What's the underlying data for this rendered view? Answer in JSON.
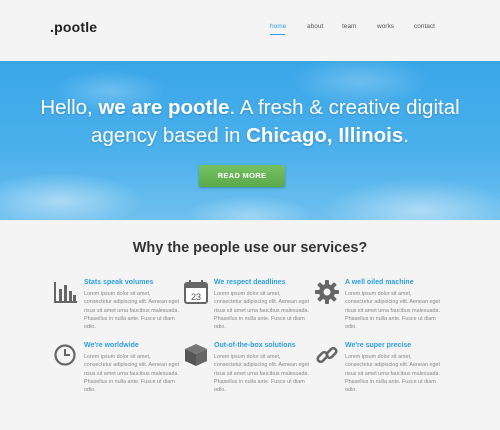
{
  "header": {
    "logo": ".pootle",
    "nav": [
      {
        "label": "home",
        "active": true
      },
      {
        "label": "about",
        "active": false
      },
      {
        "label": "team",
        "active": false
      },
      {
        "label": "works",
        "active": false
      },
      {
        "label": "contact",
        "active": false
      }
    ]
  },
  "hero": {
    "line1_prefix": "Hello, ",
    "line1_bold": "we are pootle",
    "line1_suffix": ". A fresh & creative digital",
    "line2_prefix": "agency based in ",
    "line2_bold": "Chicago, Illinois",
    "line2_suffix": ".",
    "cta_label": "READ MORE"
  },
  "services": {
    "title": "Why the people use our services?",
    "body_text": "Lorem ipsum dolor sit amet, consectetur adipiscing elit. Aenean eget risus sit amet urna faucibus malesuada. Phasellus in nulla ante. Fusce ut diam odio.",
    "items": [
      {
        "title": "Stats speak volumes",
        "icon": "bar-chart-icon"
      },
      {
        "title": "We respect deadlines",
        "icon": "calendar-icon",
        "icon_text": "23"
      },
      {
        "title": "A well oiled machine",
        "icon": "gear-icon"
      },
      {
        "title": "We're worldwide",
        "icon": "clock-icon"
      },
      {
        "title": "Out-of-the-box solutions",
        "icon": "box-icon"
      },
      {
        "title": "We're super precise",
        "icon": "chain-link-icon"
      }
    ]
  },
  "colors": {
    "accent": "#2e9fe0",
    "button": "#5fb04e",
    "hero_sky": "#3aa6e8"
  }
}
